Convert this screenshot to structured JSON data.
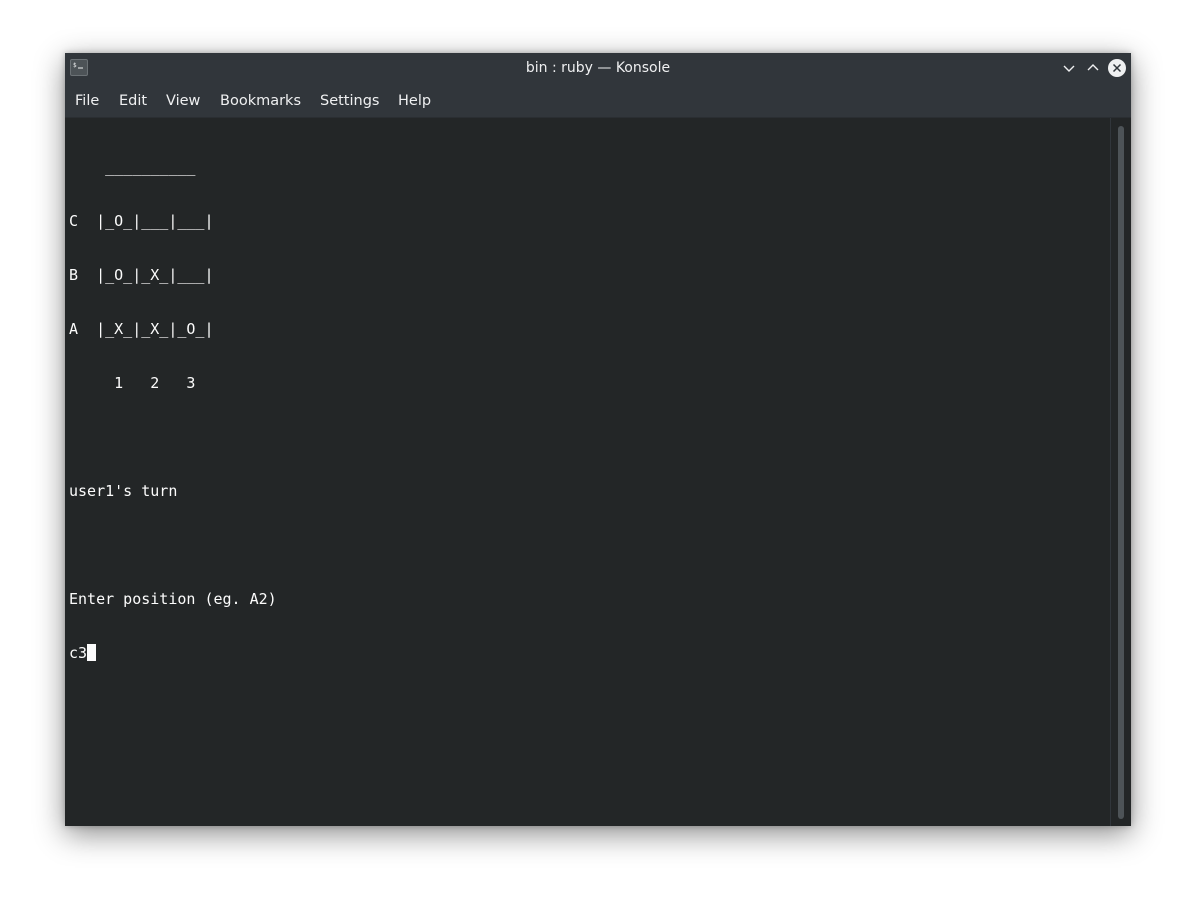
{
  "window": {
    "title": "bin : ruby — Konsole"
  },
  "titlebar": {
    "icon": "terminal-icon",
    "buttons": [
      "minimize-icon",
      "maximize-icon",
      "close-icon"
    ]
  },
  "menu": {
    "file": "File",
    "edit": "Edit",
    "view": "View",
    "bookmarks": "Bookmarks",
    "settings": "Settings",
    "help": "Help"
  },
  "terminal": {
    "lines": [
      "    __________",
      "C  |_O_|___|___|",
      "B  |_O_|_X_|___|",
      "A  |_X_|_X_|_O_|",
      "     1   2   3",
      "",
      "user1's turn",
      "",
      "Enter position (eg. A2)"
    ],
    "input": "c3"
  },
  "colors": {
    "terminal_bg": "#232627",
    "chrome_bg": "#31363b",
    "text": "#fcfcfc"
  }
}
